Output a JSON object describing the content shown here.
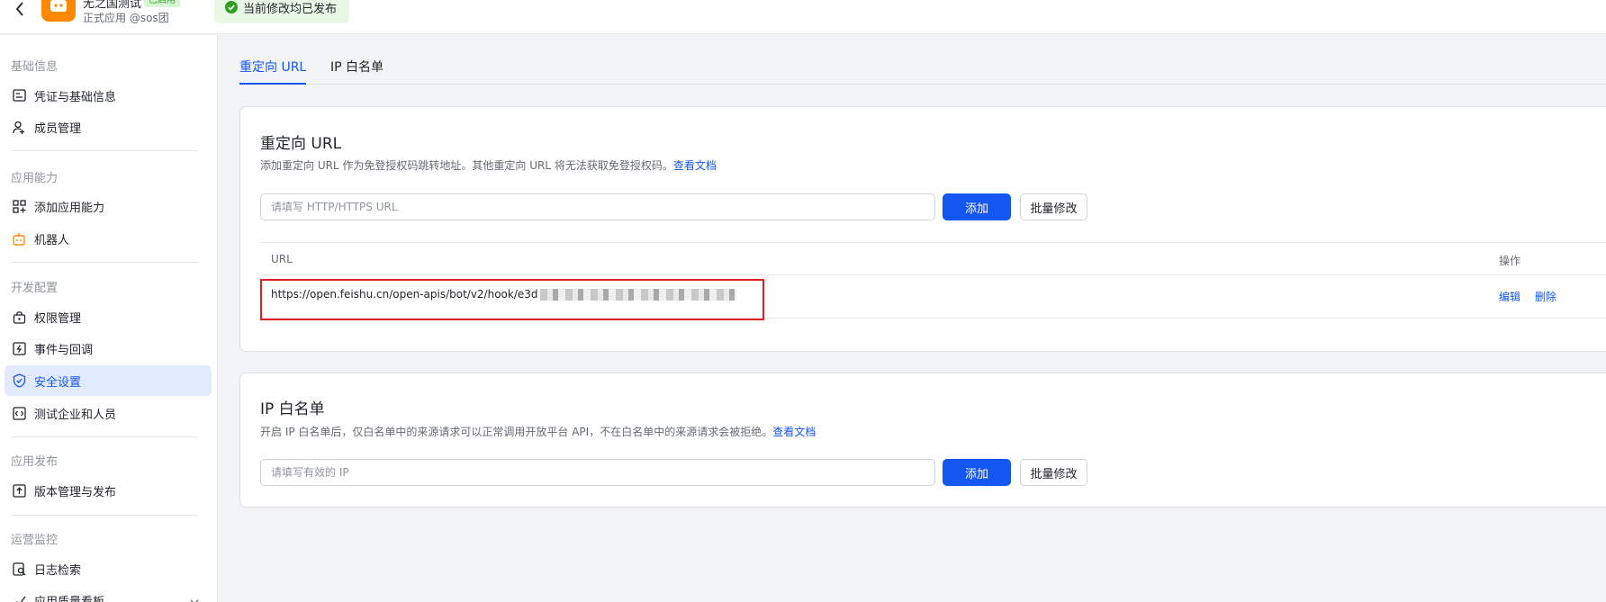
{
  "header": {
    "app_name": "无之国测试",
    "app_status": "已启用",
    "app_subtitle": "正式应用 @sos团",
    "publish_status": "当前修改均已发布"
  },
  "sidebar": {
    "groups": [
      {
        "label": "基础信息",
        "items": [
          {
            "label": "凭证与基础信息",
            "icon": "credential-icon"
          },
          {
            "label": "成员管理",
            "icon": "member-add-icon"
          }
        ]
      },
      {
        "label": "应用能力",
        "items": [
          {
            "label": "添加应用能力",
            "icon": "grid-add-icon"
          },
          {
            "label": "机器人",
            "icon": "robot-icon"
          }
        ]
      },
      {
        "label": "开发配置",
        "items": [
          {
            "label": "权限管理",
            "icon": "lock-icon"
          },
          {
            "label": "事件与回调",
            "icon": "event-icon"
          },
          {
            "label": "安全设置",
            "icon": "shield-icon",
            "active": true
          },
          {
            "label": "测试企业和人员",
            "icon": "code-icon"
          }
        ]
      },
      {
        "label": "应用发布",
        "items": [
          {
            "label": "版本管理与发布",
            "icon": "upload-icon"
          }
        ]
      },
      {
        "label": "运营监控",
        "items": [
          {
            "label": "日志检索",
            "icon": "log-search-icon"
          },
          {
            "label": "应用质量看板",
            "icon": "chart-icon"
          }
        ]
      }
    ]
  },
  "tabs": [
    {
      "label": "重定向 URL",
      "active": true
    },
    {
      "label": "IP 白名单",
      "active": false
    }
  ],
  "redirect": {
    "title": "重定向 URL",
    "description": "添加重定向 URL 作为免登授权码跳转地址。其他重定向 URL 将无法获取免登授权码。",
    "doc_link": "查看文档",
    "input_placeholder": "请填写 HTTP/HTTPS URL",
    "add_label": "添加",
    "batch_label": "批量修改",
    "table": {
      "col_url": "URL",
      "col_actions": "操作",
      "rows": [
        {
          "url": "https://open.feishu.cn/open-apis/bot/v2/hook/e3d",
          "edit": "编辑",
          "delete": "删除"
        }
      ]
    }
  },
  "whitelist": {
    "title": "IP 白名单",
    "description": "开启 IP 白名单后，仅白名单中的来源请求可以正常调用开放平台 API，不在白名单中的来源请求会被拒绝。",
    "doc_link": "查看文档",
    "input_placeholder": "请填写有效的 IP",
    "add_label": "添加",
    "batch_label": "批量修改"
  },
  "colors": {
    "accent": "#1456f0",
    "active_bg": "#e1eaff",
    "success": "#2ea121",
    "highlight_border": "#e02020"
  }
}
